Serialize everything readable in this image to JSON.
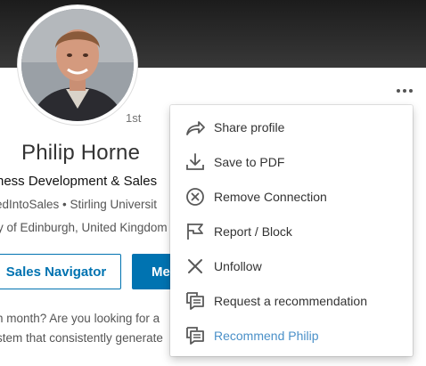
{
  "profile": {
    "name": "Philip Horne",
    "degree": "1st",
    "headline": "ness Development & Sales",
    "subline": "edIntoSales • Stirling Universit",
    "location": "y of Edinburgh, United Kingdom"
  },
  "actions": {
    "navigator_label": "Sales Navigator",
    "message_label": "Me"
  },
  "summary": {
    "line1": "n month? Are you looking for a",
    "line2": "stem that consistently generate"
  },
  "menu": {
    "items": [
      {
        "label": "Share profile",
        "icon": "share-icon"
      },
      {
        "label": "Save to PDF",
        "icon": "download-icon"
      },
      {
        "label": "Remove Connection",
        "icon": "remove-circle-icon"
      },
      {
        "label": "Report / Block",
        "icon": "flag-icon"
      },
      {
        "label": "Unfollow",
        "icon": "close-icon"
      },
      {
        "label": "Request a recommendation",
        "icon": "speech-bubble-icon"
      },
      {
        "label": "Recommend Philip",
        "icon": "speech-bubble-icon"
      }
    ]
  },
  "colors": {
    "accent": "#0073b1",
    "link": "#4a90c8",
    "cover": "#2a2a2a"
  }
}
